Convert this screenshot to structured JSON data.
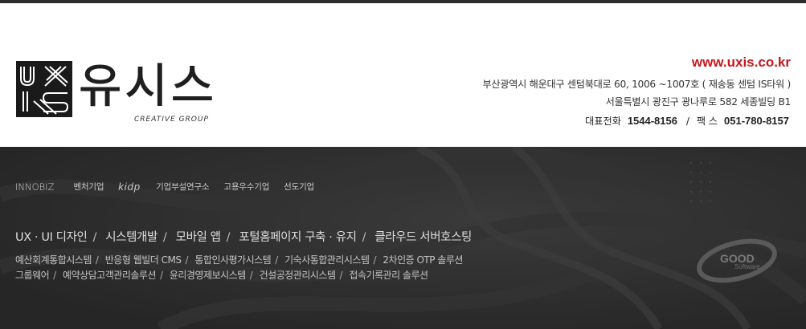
{
  "brand": {
    "name": "유시스",
    "tagline": "CREATIVE GROUP",
    "mark_text": "UXIS"
  },
  "contact": {
    "url": "www.uxis.co.kr",
    "address_busan": "부산광역시 해운대구 센텀북대로 60, 1006 ~1007호 ( 재송동 센텀 IS타워 )",
    "address_seoul": "서울특별시 광진구 광나루로 582 세종빌딩 B1",
    "phone_label": "대표전화",
    "phone": "1544-8156",
    "fax_label": "팩 스",
    "fax": "051-780-8157"
  },
  "certifications": [
    "INNOBIZ",
    "벤처기업",
    "kidp",
    "기업부설연구소",
    "고용우수기업",
    "선도기업"
  ],
  "services": {
    "main": [
      "UX · UI 디자인",
      "시스템개발",
      "모바일 앱",
      "포털홈페이지 구축 · 유지",
      "클라우드 서버호스팅"
    ],
    "line1": [
      "예산회계통합시스템",
      "반응형 웹빌더 CMS",
      "통합인사평가시스템",
      "기숙사통합관리시스템",
      "2차인증 OTP 솔루션"
    ],
    "line2": [
      "그룹웨어",
      "예약상담고객관리솔루션",
      "윤리경영제보시스템",
      "건설공정관리시스템",
      "접속기록관리 솔루션"
    ]
  },
  "badge": {
    "title": "GOOD",
    "subtitle": "Software"
  },
  "colors": {
    "accent_red": "#c8161d",
    "footer_bg": "#2a2a2a",
    "logo_dark": "#1a1a1a"
  }
}
